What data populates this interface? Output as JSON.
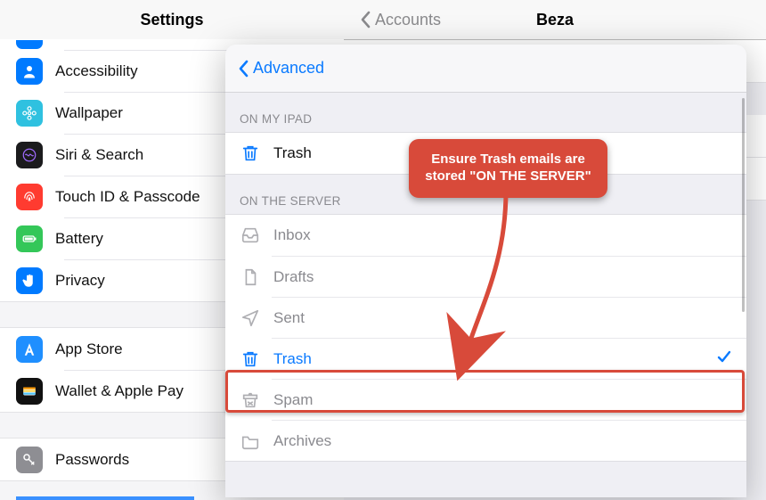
{
  "left": {
    "title": "Settings",
    "group1": [
      {
        "label": "Accessibility",
        "icon": "accessibility-icon"
      },
      {
        "label": "Wallpaper",
        "icon": "wallpaper-icon"
      },
      {
        "label": "Siri & Search",
        "icon": "siri-icon"
      },
      {
        "label": "Touch ID & Passcode",
        "icon": "touchid-icon"
      },
      {
        "label": "Battery",
        "icon": "battery-icon"
      },
      {
        "label": "Privacy",
        "icon": "privacy-icon"
      }
    ],
    "group2": [
      {
        "label": "App Store",
        "icon": "appstore-icon"
      },
      {
        "label": "Wallet & Apple Pay",
        "icon": "wallet-icon"
      }
    ],
    "group3": [
      {
        "label": "Passwords",
        "icon": "passwords-icon"
      }
    ]
  },
  "right": {
    "back": "Accounts",
    "title": "Beza"
  },
  "modal": {
    "back": "Advanced",
    "section1_label": "ON MY IPAD",
    "ipad_rows": [
      {
        "label": "Trash",
        "icon": "trash-icon",
        "active": true
      }
    ],
    "section2_label": "ON THE SERVER",
    "server_rows": [
      {
        "label": "Inbox",
        "icon": "inbox-icon"
      },
      {
        "label": "Drafts",
        "icon": "drafts-icon"
      },
      {
        "label": "Sent",
        "icon": "sent-icon"
      },
      {
        "label": "Trash",
        "icon": "trash-icon",
        "active": true,
        "checked": true
      },
      {
        "label": "Spam",
        "icon": "spam-icon"
      },
      {
        "label": "Archives",
        "icon": "archives-icon"
      }
    ]
  },
  "annotation": {
    "text": "Ensure Trash emails are stored \"ON THE SERVER\""
  },
  "colors": {
    "ios_blue": "#007aff",
    "callout_red": "#d84a3a",
    "inactive_grey": "#8a8a8f"
  }
}
